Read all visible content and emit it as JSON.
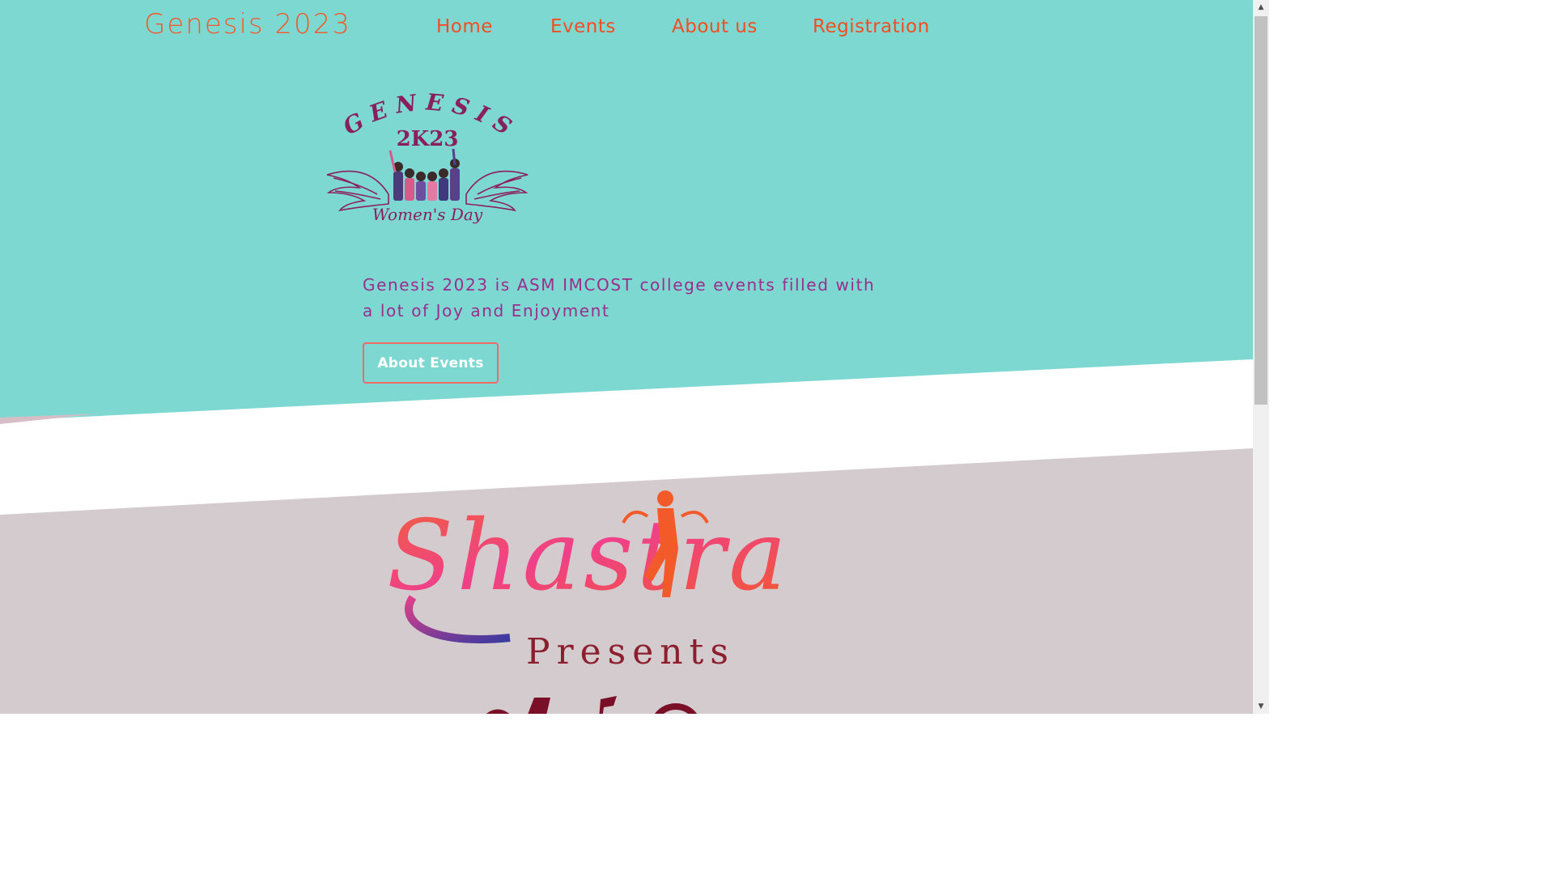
{
  "nav": {
    "brand": "Genesis 2023",
    "links": [
      {
        "label": "Home"
      },
      {
        "label": "Events"
      },
      {
        "label": "About us"
      },
      {
        "label": "Registration"
      }
    ]
  },
  "hero": {
    "logo": {
      "arc_text": "GENESIS",
      "year_text": "2K23",
      "tagline": "Women's Day"
    },
    "description": "Genesis 2023 is ASM IMCOST college events filled with a lot of Joy and Enjoyment",
    "button_label": "About Events"
  },
  "feature": {
    "title_art_text": "Shastra",
    "presents": "Presents"
  },
  "scrollbar": {
    "up_icon": "▲",
    "down_icon": "▼"
  },
  "colors": {
    "hero_bg": "#7dd8d2",
    "accent_orange": "#f25a2a",
    "text_purple": "#9a2e8c",
    "section_bg": "#d4cbce",
    "presents_red": "#8c1f2e"
  }
}
